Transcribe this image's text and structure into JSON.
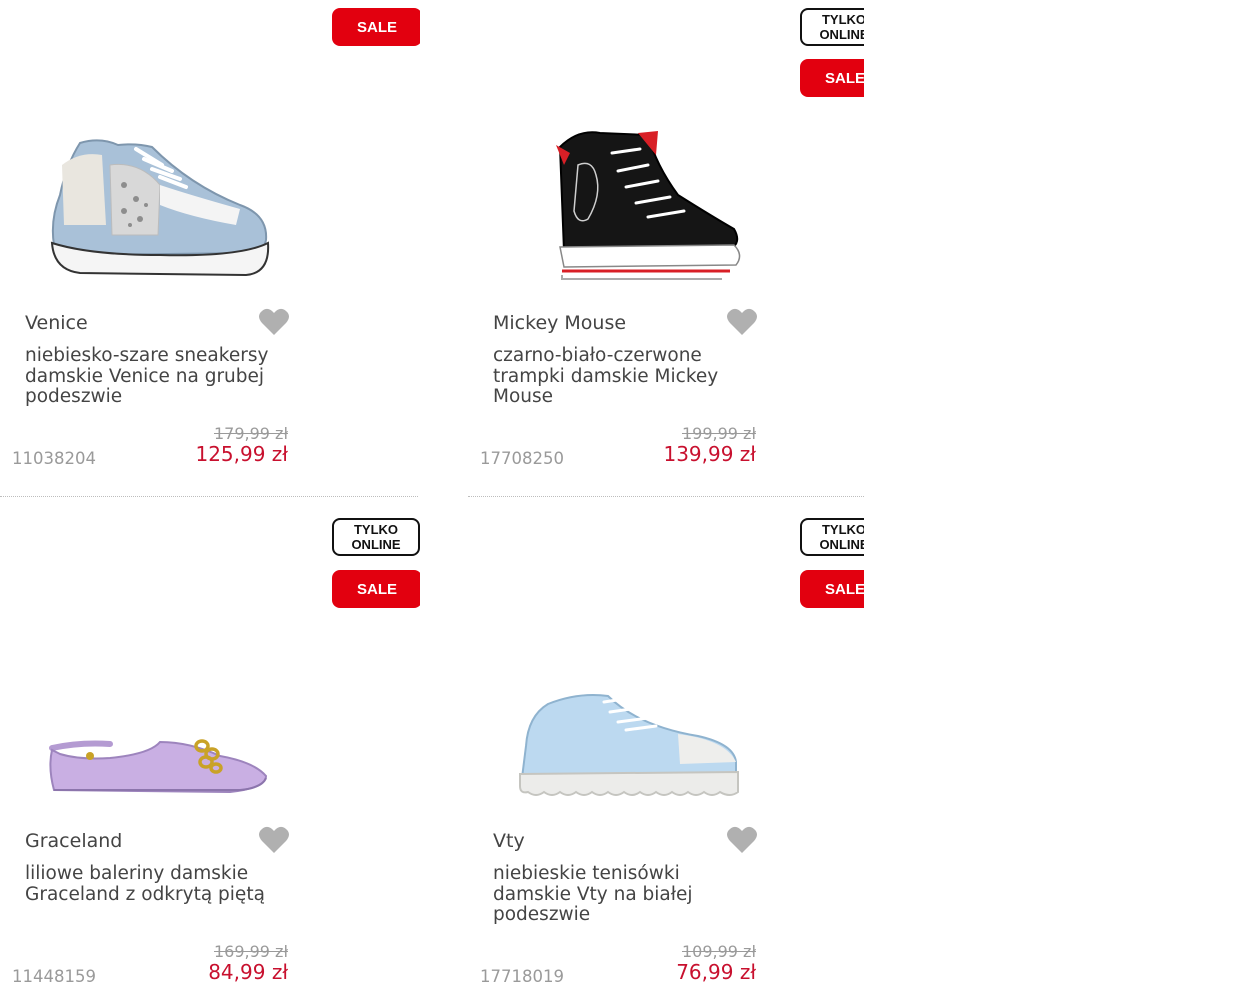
{
  "products": [
    {
      "brand": "Venice",
      "description": "niebiesko-szare sneakersy damskie Venice na grubej podeszwie",
      "sku": "11038204",
      "old_price": "179,99 zł",
      "new_price": "125,99 zł",
      "badges": {
        "sale": "SALE"
      },
      "image_icon": "sneaker-blue-grey-icon"
    },
    {
      "brand": "Mickey Mouse",
      "description": "czarno-biało-czerwone trampki damskie Mickey Mouse",
      "sku": "17708250",
      "old_price": "199,99 zł",
      "new_price": "139,99 zł",
      "badges": {
        "online_line1": "TYLKO",
        "online_line2": "ONLINE",
        "sale": "SALE"
      },
      "image_icon": "hightop-black-icon"
    },
    {
      "brand": "Graceland",
      "description": "liliowe baleriny damskie Graceland z odkrytą piętą",
      "sku": "11448159",
      "old_price": "169,99 zł",
      "new_price": "84,99 zł",
      "badges": {
        "online_line1": "TYLKO",
        "online_line2": "ONLINE",
        "sale": "SALE"
      },
      "image_icon": "ballerina-lilac-icon"
    },
    {
      "brand": "Vty",
      "description": "niebieskie tenisówki damskie Vty na białej podeszwie",
      "sku": "17718019",
      "old_price": "109,99 zł",
      "new_price": "76,99 zł",
      "badges": {
        "online_line1": "TYLKO",
        "online_line2": "ONLINE",
        "sale": "SALE"
      },
      "image_icon": "sneaker-light-blue-icon"
    }
  ],
  "colors": {
    "sale_red": "#e2000f",
    "price_red": "#c8102e",
    "muted_grey": "#9a9a9a",
    "text": "#444444",
    "heart_grey": "#b0b0b0"
  }
}
